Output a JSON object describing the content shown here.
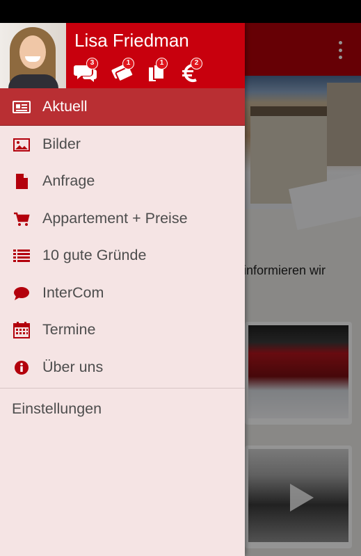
{
  "user": {
    "name": "Lisa Friedman"
  },
  "header_icons": [
    {
      "name": "chat-icon",
      "badge": "3"
    },
    {
      "name": "tickets-icon",
      "badge": "1"
    },
    {
      "name": "documents-icon",
      "badge": "1"
    },
    {
      "name": "euro-icon",
      "badge": "2"
    }
  ],
  "menu": {
    "items": [
      {
        "label": "Aktuell",
        "icon": "newspaper-icon",
        "active": true
      },
      {
        "label": "Bilder",
        "icon": "image-icon",
        "active": false
      },
      {
        "label": "Anfrage",
        "icon": "file-icon",
        "active": false
      },
      {
        "label": "Appartement + Preise",
        "icon": "cart-icon",
        "active": false
      },
      {
        "label": "10 gute Gründe",
        "icon": "list-icon",
        "active": false
      },
      {
        "label": "InterCom",
        "icon": "comment-icon",
        "active": false
      },
      {
        "label": "Termine",
        "icon": "calendar-icon",
        "active": false
      },
      {
        "label": "Über uns",
        "icon": "info-icon",
        "active": false
      }
    ],
    "settings_label": "Einstellungen"
  },
  "background": {
    "article_snippet": "informieren wir"
  },
  "colors": {
    "brand_red": "#c8000d",
    "active_item": "#b92f33",
    "drawer_bg": "#f5e4e4",
    "icon_red": "#b3000c"
  }
}
